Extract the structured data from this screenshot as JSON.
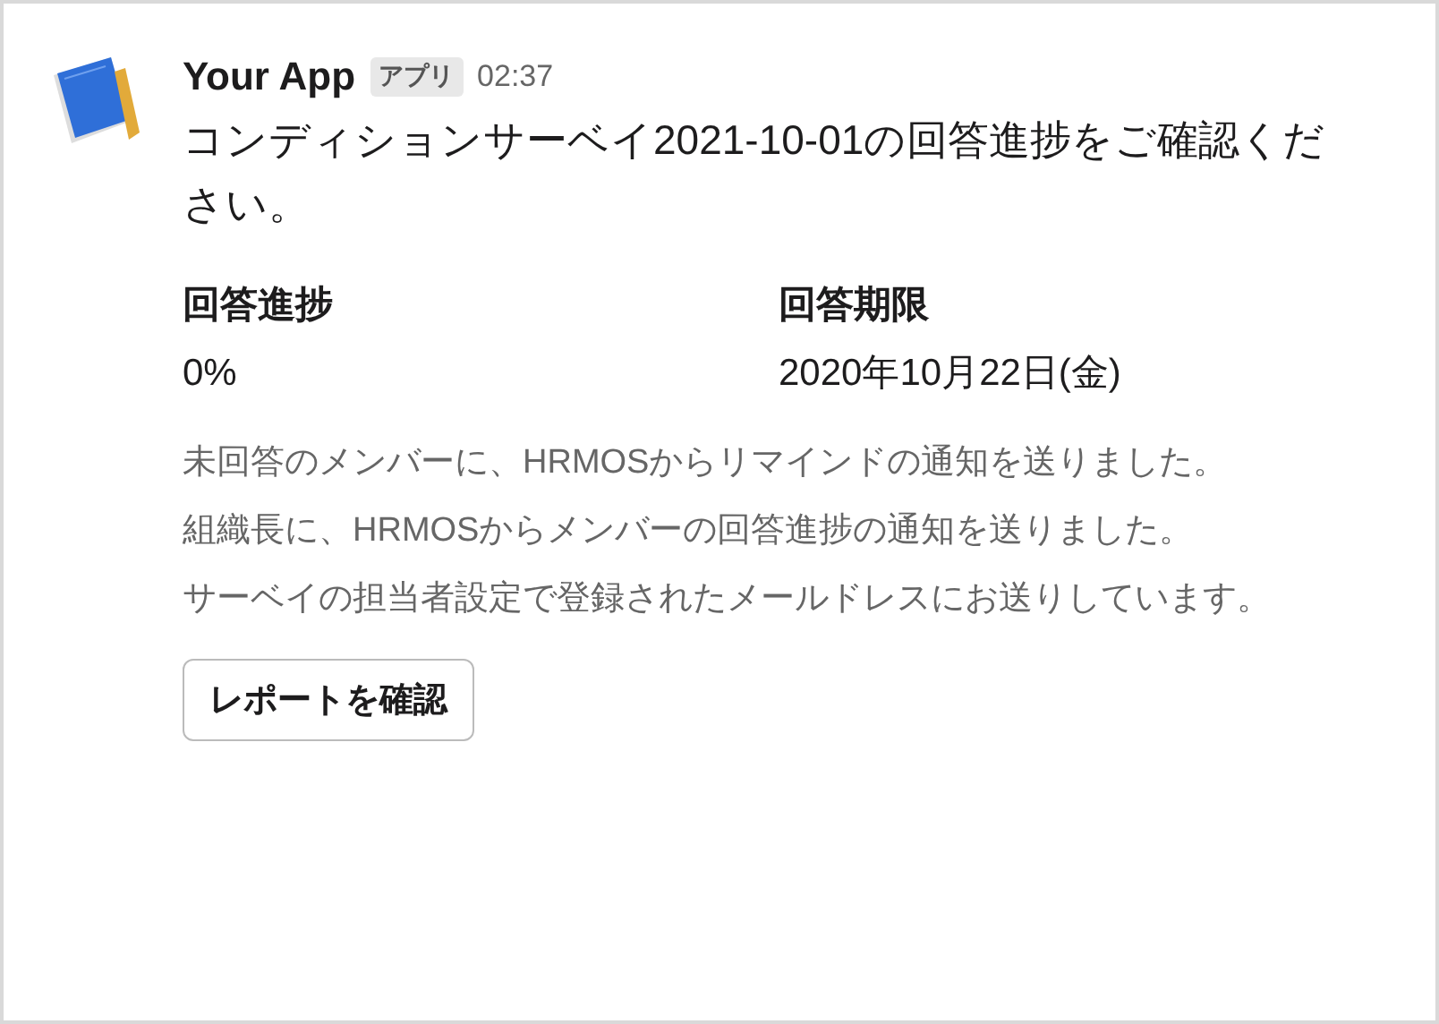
{
  "message": {
    "sender": "Your App",
    "badge": "アプリ",
    "time": "02:37",
    "text": "コンディションサーベイ2021-10-01の回答進捗をご確認ください。",
    "fields": [
      {
        "label": "回答進捗",
        "value": "0%"
      },
      {
        "label": "回答期限",
        "value": "2020年10月22日(金)"
      }
    ],
    "context": [
      "未回答のメンバーに、HRMOSからリマインドの通知を送りました。",
      "組織長に、HRMOSからメンバーの回答進捗の通知を送りました。",
      "サーベイの担当者設定で登録されたメールドレスにお送りしています。"
    ],
    "button": "レポートを確認"
  }
}
